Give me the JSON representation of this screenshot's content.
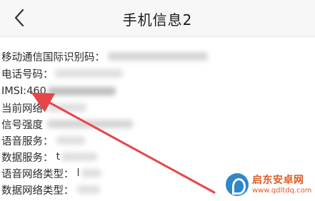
{
  "header": {
    "title": "手机信息2"
  },
  "info": {
    "rows": [
      {
        "label": "移动通信国际识别码：",
        "value": ""
      },
      {
        "label": "电话号码：",
        "value": ""
      },
      {
        "label": "IMSI: ",
        "value": "460"
      },
      {
        "label": "当前网络",
        "value": ""
      },
      {
        "label": "信号强度",
        "value": ""
      },
      {
        "label": "语音服务：",
        "value": ""
      },
      {
        "label": "数据服务：",
        "value": "t"
      },
      {
        "label": "语音网络类型：",
        "value": "l"
      },
      {
        "label": "数据网络类型：",
        "value": ""
      }
    ]
  },
  "annotation": {
    "arrow_color": "#e8454a",
    "points_to": "IMSI"
  },
  "watermark": {
    "name": "启东安卓网",
    "url": "www.qdltdq.com",
    "accent": "#e05a24",
    "logo_color": "#2f86c9"
  }
}
